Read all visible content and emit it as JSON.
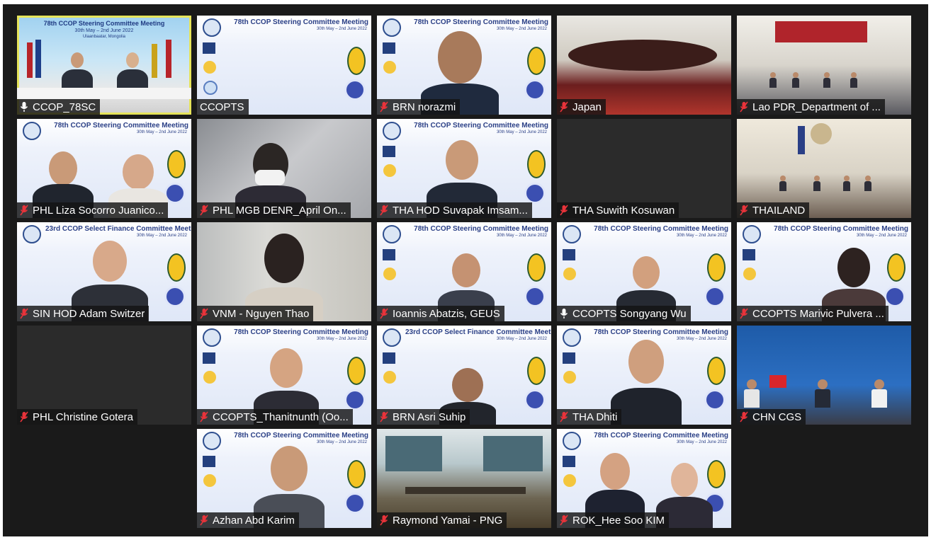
{
  "meeting": {
    "banner_title": "78th CCOP Steering Committee Meeting",
    "banner_dates": "30th May – 2nd June 2022",
    "banner_location": "Ulaanbaatar, Mongolia",
    "banner_title_alt": "23rd CCOP Select Finance Committee Meeting",
    "main_banner_title": "78th CCOP Steering Committee Meeting",
    "main_banner_dates": "30th May – 2nd June 2022",
    "main_banner_location": "Ulaanbaatar, Mongolia"
  },
  "participants": [
    {
      "name": "CCOP_78SC",
      "active": true,
      "mic_muted": false
    },
    {
      "name": "CCOPTS"
    },
    {
      "name": "BRN norazmi",
      "mic_muted": true
    },
    {
      "name": "Japan",
      "mic_muted": true
    },
    {
      "name": "Lao PDR_Department of ...",
      "mic_muted": true
    },
    {
      "name": "PHL Liza Socorro Juanico...",
      "mic_muted": true
    },
    {
      "name": "PHL MGB DENR_April On...",
      "mic_muted": true
    },
    {
      "name": "THA HOD Suvapak Imsam...",
      "mic_muted": true
    },
    {
      "name": "THA Suwith Kosuwan",
      "mic_muted": true
    },
    {
      "name": "THAILAND",
      "mic_muted": true
    },
    {
      "name": "SIN HOD Adam Switzer",
      "mic_muted": true
    },
    {
      "name": "VNM - Nguyen Thao",
      "mic_muted": true
    },
    {
      "name": "Ioannis Abatzis, GEUS",
      "mic_muted": true
    },
    {
      "name": "CCOPTS Songyang Wu",
      "mic_muted": false
    },
    {
      "name": "CCOPTS Marivic Pulvera ...",
      "mic_muted": true
    },
    {
      "name": "PHL Christine Gotera",
      "mic_muted": true
    },
    {
      "name": "CCOPTS_Thanitnunth (Oo...",
      "mic_muted": true
    },
    {
      "name": "BRN Asri Suhip",
      "mic_muted": true
    },
    {
      "name": "THA Dhiti",
      "mic_muted": true
    },
    {
      "name": "CHN CGS",
      "mic_muted": true
    },
    {
      "name": "Azhan Abd Karim",
      "mic_muted": true
    },
    {
      "name": "Raymond Yamai - PNG",
      "mic_muted": true
    },
    {
      "name": "ROK_Hee Soo KIM",
      "mic_muted": true
    }
  ],
  "colors": {
    "active_border": "#e6e45a",
    "mic_muted": "#e8333a",
    "namebar_bg": "#141414",
    "gallery_bg": "#1a1a1a"
  },
  "icons": {
    "muted_mic": "muted-microphone-icon",
    "mic": "microphone-icon"
  }
}
